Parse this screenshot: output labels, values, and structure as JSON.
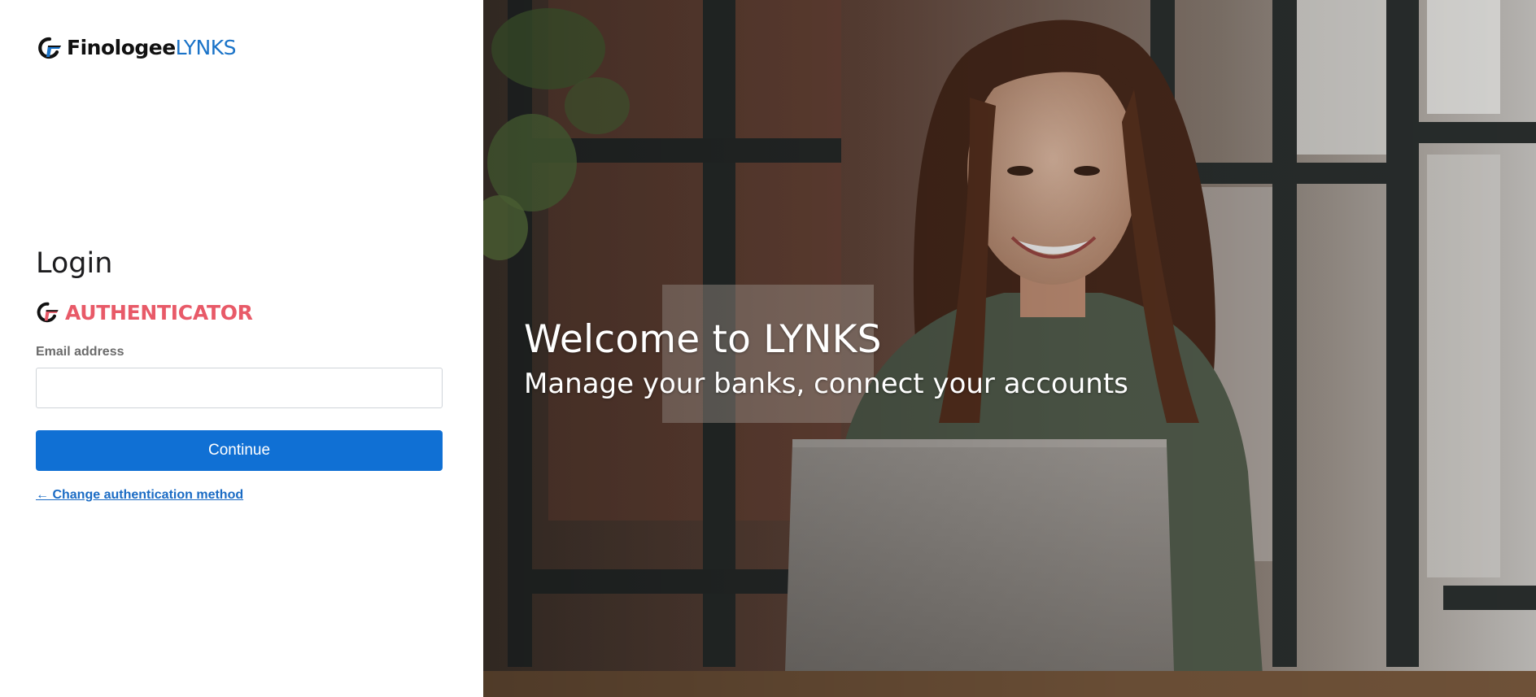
{
  "brand": {
    "name": "Finologee",
    "suffix": "LYNKS",
    "mark_icon": "finologee-logo-icon",
    "name_color": "#111111",
    "suffix_color": "#1a73c8"
  },
  "login": {
    "title": "Login",
    "method": {
      "icon": "finologee-logo-icon",
      "label": "AUTHENTICATOR",
      "color": "#e85a68"
    },
    "email": {
      "label": "Email address",
      "value": "",
      "placeholder": ""
    },
    "continue_label": "Continue",
    "continue_color": "#1070d4",
    "change_method_label": "← Change authentication method"
  },
  "hero": {
    "title": "Welcome to LYNKS",
    "subtitle": "Manage your banks, connect your accounts",
    "image": "woman-smiling-at-laptop-photo"
  }
}
